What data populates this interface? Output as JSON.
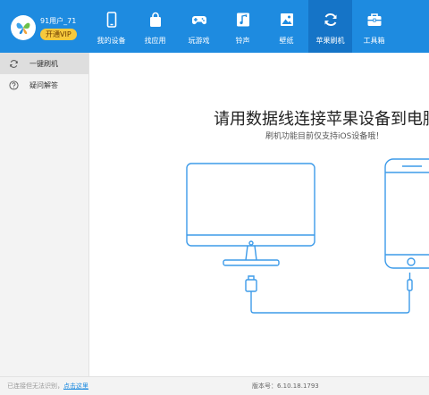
{
  "profile": {
    "username": "91用户_71",
    "vip_label": "开通VIP"
  },
  "nav": [
    {
      "label": "我的设备",
      "icon": "phone-icon"
    },
    {
      "label": "找应用",
      "icon": "bag-icon"
    },
    {
      "label": "玩游戏",
      "icon": "gamepad-icon"
    },
    {
      "label": "铃声",
      "icon": "music-icon"
    },
    {
      "label": "壁纸",
      "icon": "image-icon"
    },
    {
      "label": "苹果刷机",
      "icon": "refresh-icon",
      "active": true
    },
    {
      "label": "工具箱",
      "icon": "toolbox-icon"
    }
  ],
  "sidebar": [
    {
      "label": "一键刷机",
      "icon": "refresh-icon",
      "active": true
    },
    {
      "label": "疑问解答",
      "icon": "question-icon"
    }
  ],
  "main": {
    "title": "请用数据线连接苹果设备到电脑",
    "subtitle": "刷机功能目前仅支持iOS设备哦！"
  },
  "status": {
    "message": "已连接但无法识别，",
    "link": "点击这里",
    "version": "版本号：6.10.18.1793"
  },
  "colors": {
    "accent": "#1e8be0",
    "accent_dark": "#1574c7",
    "vip": "#f7c93c",
    "illustration": "#3d9be9"
  }
}
